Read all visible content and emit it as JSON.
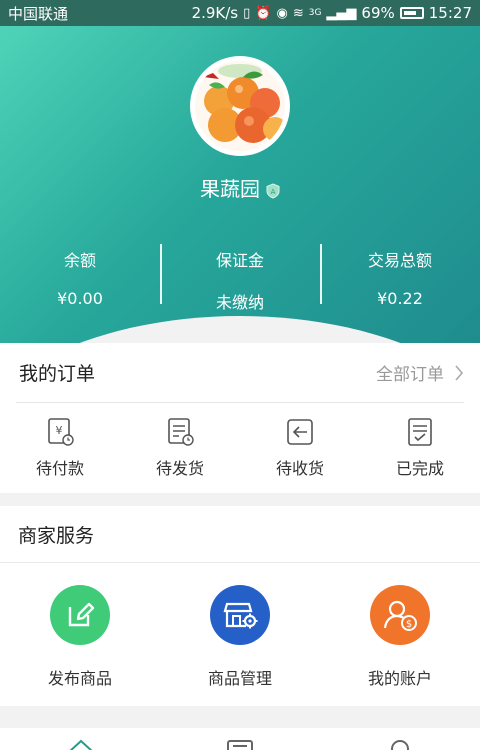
{
  "status_bar": {
    "carrier": "中国联通",
    "speed": "2.9K/s",
    "network": "3G",
    "battery": "69%",
    "time": "15:27"
  },
  "profile": {
    "store_name": "果蔬园"
  },
  "stats": [
    {
      "label": "余额",
      "value": "¥0.00"
    },
    {
      "label": "保证金",
      "value": "未缴纳"
    },
    {
      "label": "交易总额",
      "value": "¥0.22"
    }
  ],
  "orders": {
    "title": "我的订单",
    "all_label": "全部订单",
    "items": [
      {
        "label": "待付款",
        "icon": "pending-payment-icon"
      },
      {
        "label": "待发货",
        "icon": "pending-shipment-icon"
      },
      {
        "label": "待收货",
        "icon": "pending-receipt-icon"
      },
      {
        "label": "已完成",
        "icon": "completed-icon"
      }
    ]
  },
  "services": {
    "title": "商家服务",
    "items": [
      {
        "label": "发布商品",
        "icon": "edit-icon",
        "color": "#3fcb78"
      },
      {
        "label": "商品管理",
        "icon": "store-gear-icon",
        "color": "#2560c9"
      },
      {
        "label": "我的账户",
        "icon": "account-icon",
        "color": "#f0742a"
      }
    ]
  },
  "tabbar": {
    "items": [
      "home-icon",
      "list-icon",
      "user-icon"
    ]
  },
  "colors": {
    "hero_start": "#4fd3b8",
    "hero_end": "#1f8c8e"
  }
}
